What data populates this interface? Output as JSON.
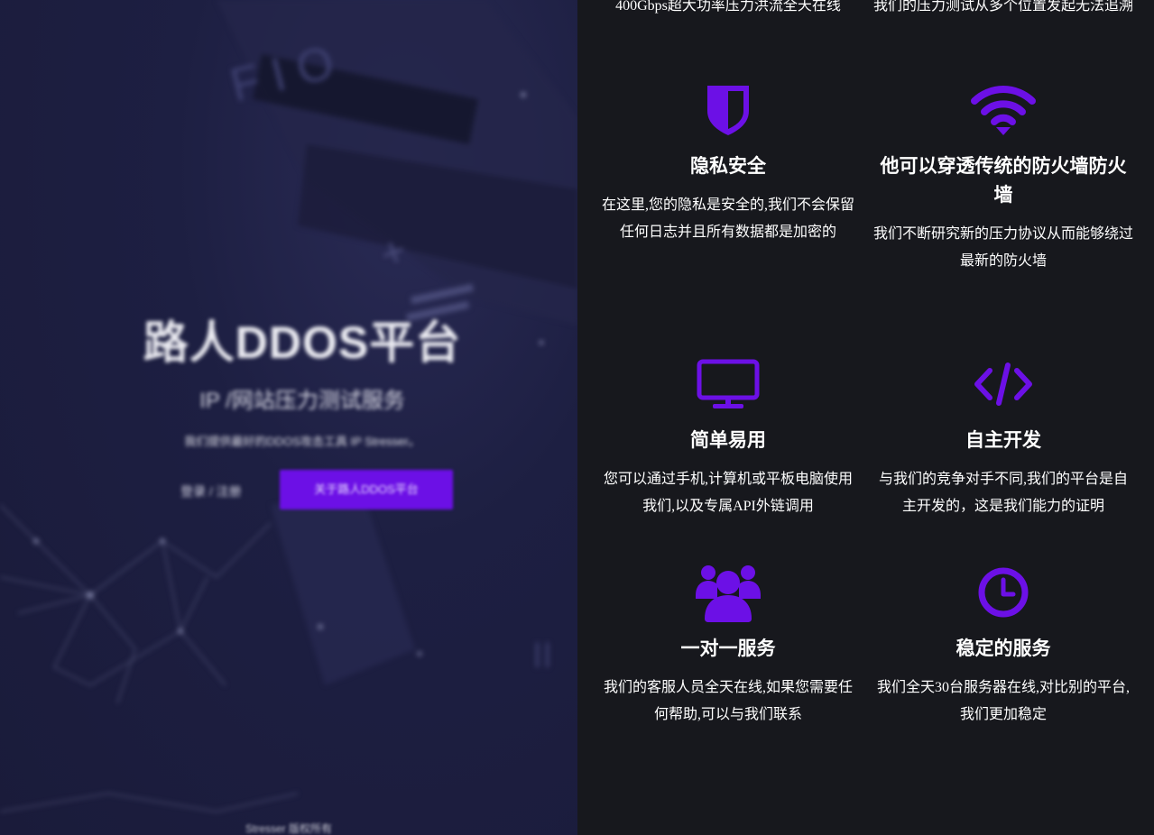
{
  "hero": {
    "title": "路人DDOS平台",
    "subtitle": "IP /网站压力测试服务",
    "description": "我们提供最好的DDOS攻击工具 IP Stresser。",
    "login_label": "登录 / 注册",
    "about_label": "关于路人DDOS平台",
    "copyright": "Stresser 版权所有"
  },
  "top_texts": {
    "left": "400Gbps超大功率压力洪流全天在线",
    "right": "我们的压力测试从多个位置发起无法追溯"
  },
  "features": [
    {
      "icon": "shield-icon",
      "title": "隐私安全",
      "desc": "在这里,您的隐私是安全的,我们不会保留任何日志并且所有数据都是加密的"
    },
    {
      "icon": "wifi-icon",
      "title": "他可以穿透传统的防火墙防火墙",
      "desc": "我们不断研究新的压力协议从而能够绕过最新的防火墙"
    },
    {
      "icon": "monitor-icon",
      "title": "简单易用",
      "desc": "您可以通过手机,计算机或平板电脑使用我们,以及专属API外链调用"
    },
    {
      "icon": "code-icon",
      "title": "自主开发",
      "desc": "与我们的竞争对手不同,我们的平台是自主开发的，这是我们能力的证明"
    },
    {
      "icon": "users-icon",
      "title": "一对一服务",
      "desc": "我们的客服人员全天在线,如果您需要任何帮助,可以与我们联系"
    },
    {
      "icon": "clock-icon",
      "title": "稳定的服务",
      "desc": "我们全天30台服务器在线,对比别的平台,我们更加稳定"
    }
  ],
  "colors": {
    "accent": "#6c10e6",
    "panel_bg": "#17181d",
    "hero_bg": "#1d1f42"
  }
}
